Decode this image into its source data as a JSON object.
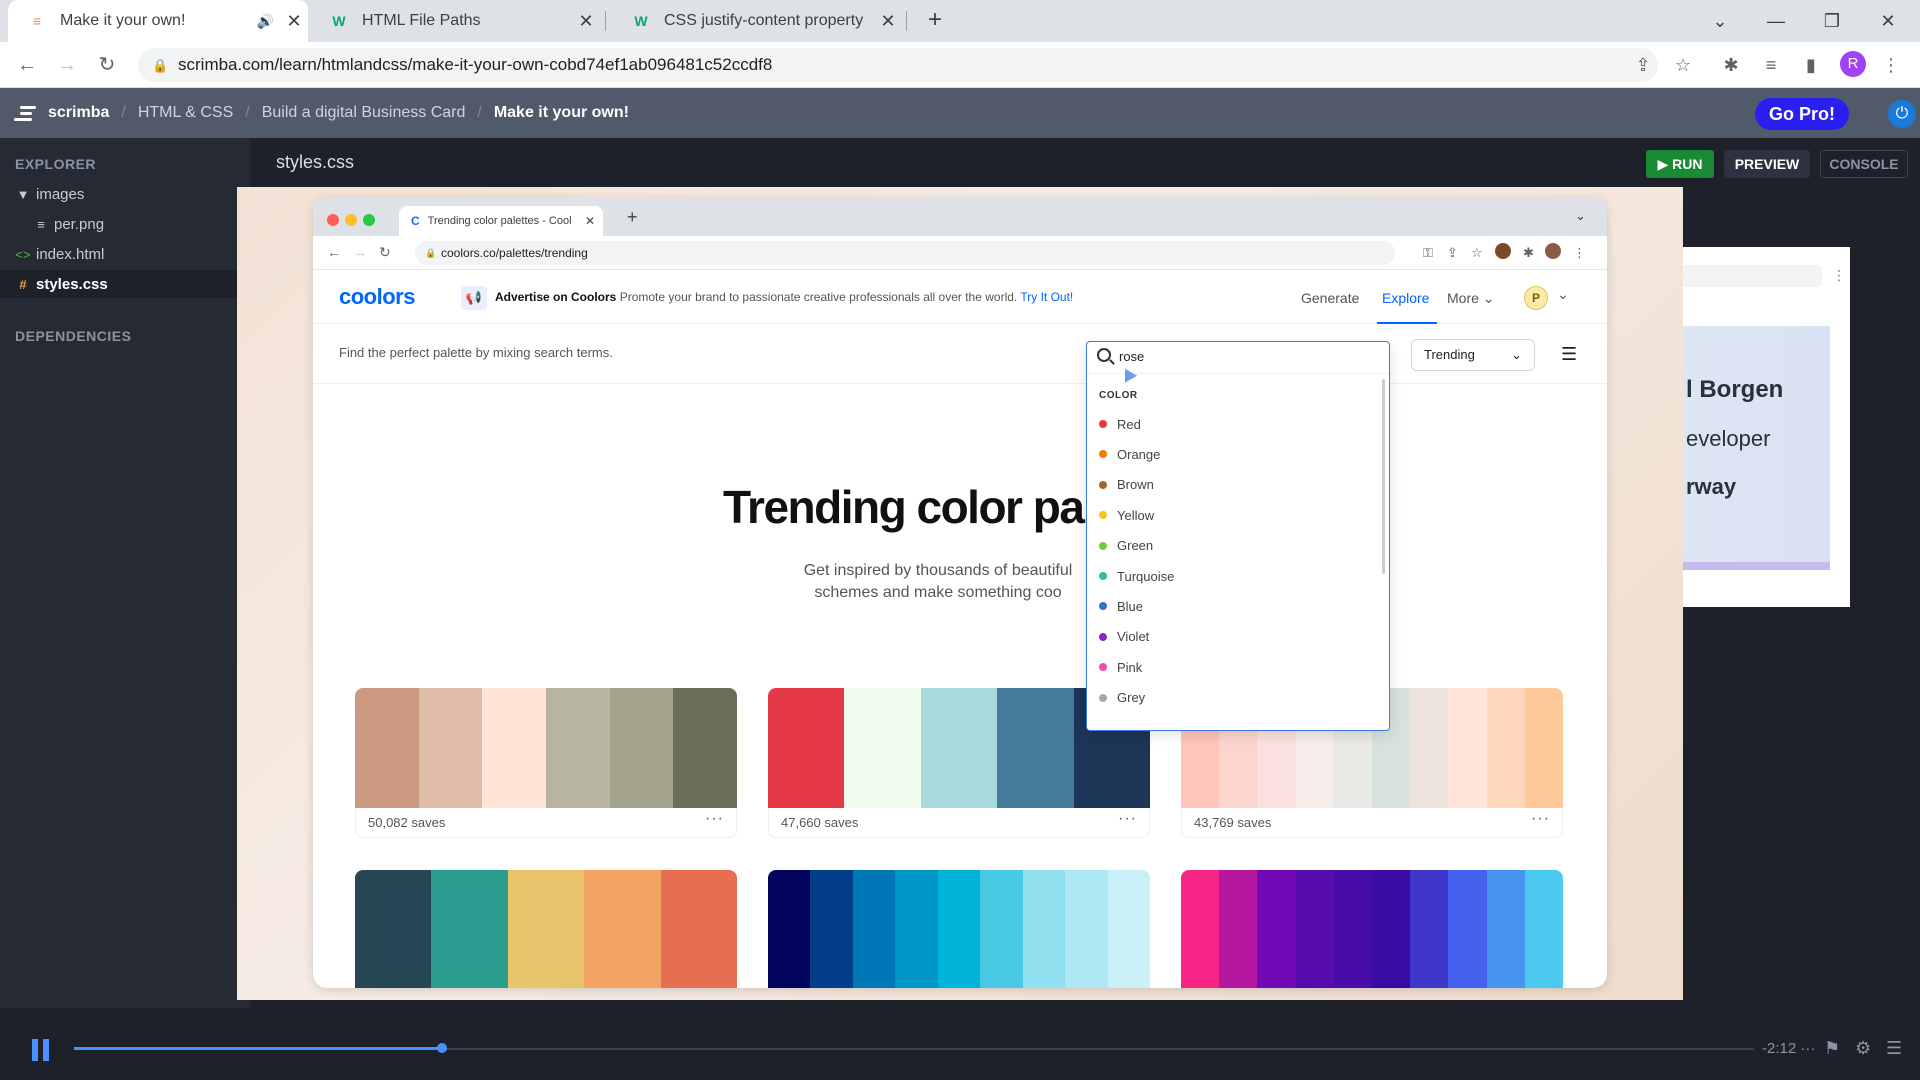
{
  "browser": {
    "tabs": [
      {
        "title": "Make it your own!",
        "active": true
      },
      {
        "title": "HTML File Paths",
        "active": false
      },
      {
        "title": "CSS justify-content property",
        "active": false
      }
    ],
    "url": "scrimba.com/learn/htmlandcss/make-it-your-own-cobd74ef1ab096481c52ccdf8",
    "profile_initial": "R"
  },
  "scrimba": {
    "logo": "scrimba",
    "breadcrumb": [
      "HTML & CSS",
      "Build a digital Business Card",
      "Make it your own!"
    ],
    "go_pro": "Go Pro!"
  },
  "sidebar": {
    "explorer_label": "EXPLORER",
    "items": [
      {
        "label": "images",
        "icon": "folder-caret-icon"
      },
      {
        "label": "per.png",
        "icon": "file-icon"
      },
      {
        "label": "index.html",
        "icon": "html-code-icon"
      },
      {
        "label": "styles.css",
        "icon": "hash-icon"
      }
    ],
    "dependencies_label": "DEPENDENCIES"
  },
  "editor": {
    "file_title": "styles.css",
    "run_label": "RUN",
    "preview_label": "PREVIEW",
    "console_label": "CONSOLE"
  },
  "preview_snippet": {
    "name_fragment": "l Borgen",
    "role_fragment": "eveloper",
    "location_fragment": "rway"
  },
  "video": {
    "inner_tab_title": "Trending color palettes - Cool",
    "inner_url": "coolors.co/palettes/trending",
    "coolors": {
      "logo": "coolors",
      "ad_title": "Advertise on Coolors",
      "ad_text": "Promote your brand to passionate creative professionals all over the world.",
      "ad_link": "Try It Out!",
      "menu": [
        "Generate",
        "Explore",
        "More"
      ],
      "avatar_initial": "P",
      "search_hint": "Find the perfect palette by mixing search terms.",
      "sort_label": "Trending",
      "heading": "Trending color pal",
      "subtitle_lines": [
        "Get inspired by thousands of beautiful",
        "schemes and make something coo"
      ],
      "search_value": "rose",
      "dropdown_header": "COLOR",
      "colors": [
        {
          "name": "Red",
          "color": "#e53935"
        },
        {
          "name": "Orange",
          "color": "#f57c00"
        },
        {
          "name": "Brown",
          "color": "#a0662a"
        },
        {
          "name": "Yellow",
          "color": "#f5c518"
        },
        {
          "name": "Green",
          "color": "#6ccf3a"
        },
        {
          "name": "Turquoise",
          "color": "#26bfa9"
        },
        {
          "name": "Blue",
          "color": "#2f6fd6"
        },
        {
          "name": "Violet",
          "color": "#8e24cc"
        },
        {
          "name": "Pink",
          "color": "#ee4ca7"
        },
        {
          "name": "Grey",
          "color": "#a5a8ad"
        }
      ],
      "palettes": [
        {
          "saves": "50,082 saves",
          "colors": [
            "#cc9a80",
            "#dfbca8",
            "#fee5d6",
            "#b7b5a1",
            "#a4a38b",
            "#6a6e58"
          ]
        },
        {
          "saves": "47,660 saves",
          "colors": [
            "#e63946",
            "#f1faee",
            "#a8dadc",
            "#457b9d",
            "#1d3557"
          ]
        },
        {
          "saves": "43,769 saves",
          "colors": [
            "#fec5bb",
            "#fcd5ce",
            "#fae1dd",
            "#f8edeb",
            "#e8e8e4",
            "#d8e2dc",
            "#ece4db",
            "#ffe5d9",
            "#ffd7ba",
            "#fec89a"
          ]
        },
        {
          "saves": "",
          "colors": [
            "#264653",
            "#2a9d8f",
            "#e9c46a",
            "#f4a261",
            "#e76f51"
          ]
        },
        {
          "saves": "",
          "colors": [
            "#03045e",
            "#023e8a",
            "#0077b6",
            "#0096c7",
            "#00b4d8",
            "#48cae4",
            "#90e0ef",
            "#ade8f4",
            "#caf0f8"
          ]
        },
        {
          "saves": "",
          "colors": [
            "#f72585",
            "#b5179e",
            "#7209b7",
            "#560bad",
            "#480ca8",
            "#3a0ca3",
            "#3f37c9",
            "#4361ee",
            "#4895ef",
            "#4cc9f0"
          ]
        }
      ]
    }
  },
  "player": {
    "progress": 0.219,
    "time_remaining": "-2:12"
  }
}
